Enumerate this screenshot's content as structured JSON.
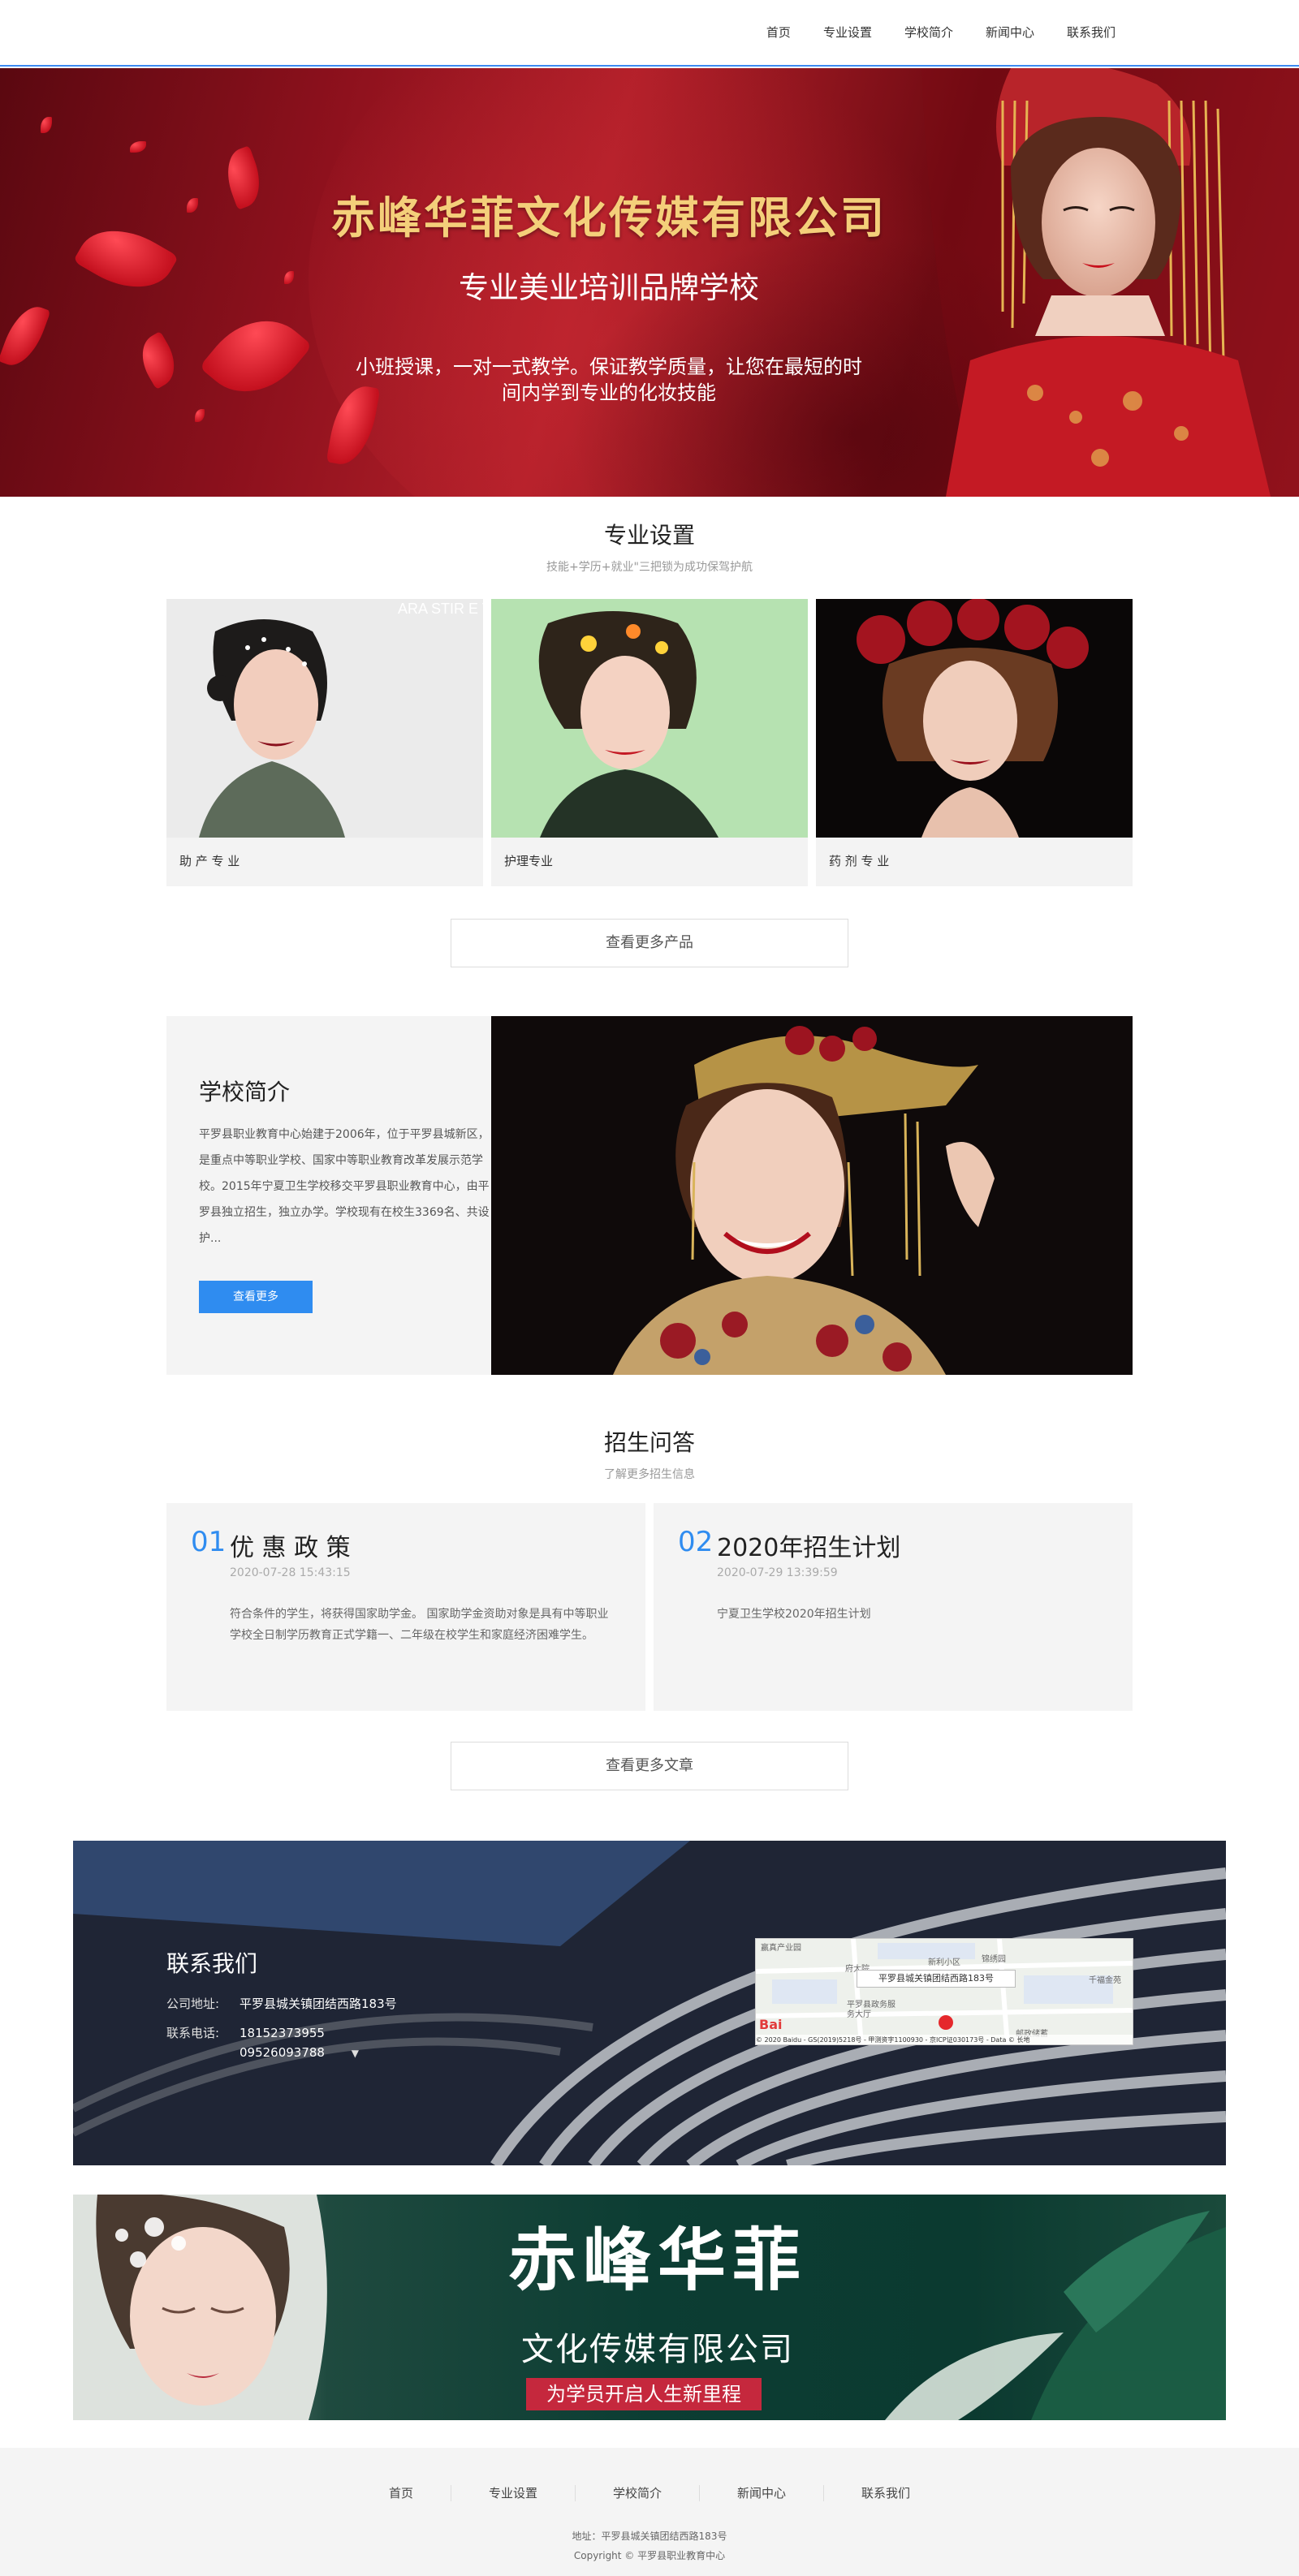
{
  "nav": {
    "items": [
      "首页",
      "专业设置",
      "学校简介",
      "新闻中心",
      "联系我们"
    ]
  },
  "banner": {
    "title": "赤峰华菲文化传媒有限公司",
    "subtitle": "专业美业培训品牌学校",
    "desc_line1": "小班授课，一对一式教学。保证教学质量，让您在最短的时",
    "desc_line2": "间内学到专业的化妆技能"
  },
  "majors": {
    "title": "专业设置",
    "subtitle": "技能+学历+就业\"三把锁为成功保驾护航",
    "items": [
      {
        "label": "助 产 专 业",
        "overlay": "ARA STIR E TONO"
      },
      {
        "label": "护理专业"
      },
      {
        "label": "药 剂 专 业"
      }
    ],
    "more": "查看更多产品"
  },
  "about": {
    "title": "学校简介",
    "text": "平罗县职业教育中心始建于2006年，位于平罗县城新区，是重点中等职业学校、国家中等职业教育改革发展示范学校。2015年宁夏卫生学校移交平罗县职业教育中心，由平罗县独立招生，独立办学。学校现有在校生3369名、共设护...",
    "button": "查看更多"
  },
  "faq": {
    "title": "招生问答",
    "subtitle": "了解更多招生信息",
    "items": [
      {
        "num": "01",
        "title": "优 惠 政 策",
        "date": "2020-07-28 15:43:15",
        "body": "符合条件的学生，将获得国家助学金。 国家助学金资助对象是具有中等职业学校全日制学历教育正式学籍一、二年级在校学生和家庭经济困难学生。"
      },
      {
        "num": "02",
        "title": "2020年招生计划",
        "date": "2020-07-29 13:39:59",
        "body": "宁夏卫生学校2020年招生计划"
      }
    ],
    "more": "查看更多文章"
  },
  "contact": {
    "title": "联系我们",
    "address_label": "公司地址:",
    "address": "平罗县城关镇团结西路183号",
    "phone_label": "联系电话:",
    "phone1": "18152373955",
    "phone2": "09526093788",
    "map": {
      "popup": "平罗县城关镇团结西路183号",
      "copyright": "© 2020 Baidu - GS(2019)5218号 - 甲测资字1100930 - 京ICP证030173号 - Data © 长地",
      "labels": [
        "新利小区",
        "锦绣园",
        "千福金苑",
        "平罗县政务服务大厅",
        "邮政储蓄",
        "府大院",
        "赢真产业园"
      ],
      "logo": "Bai"
    }
  },
  "promo": {
    "big": "赤峰华菲",
    "mid": "文化传媒有限公司",
    "tag": "为学员开启人生新里程"
  },
  "footer": {
    "nav": [
      "首页",
      "专业设置",
      "学校简介",
      "新闻中心",
      "联系我们"
    ],
    "address": "地址：平罗县城关镇团结西路183号",
    "copyright": "Copyright © 平罗县职业教育中心"
  }
}
